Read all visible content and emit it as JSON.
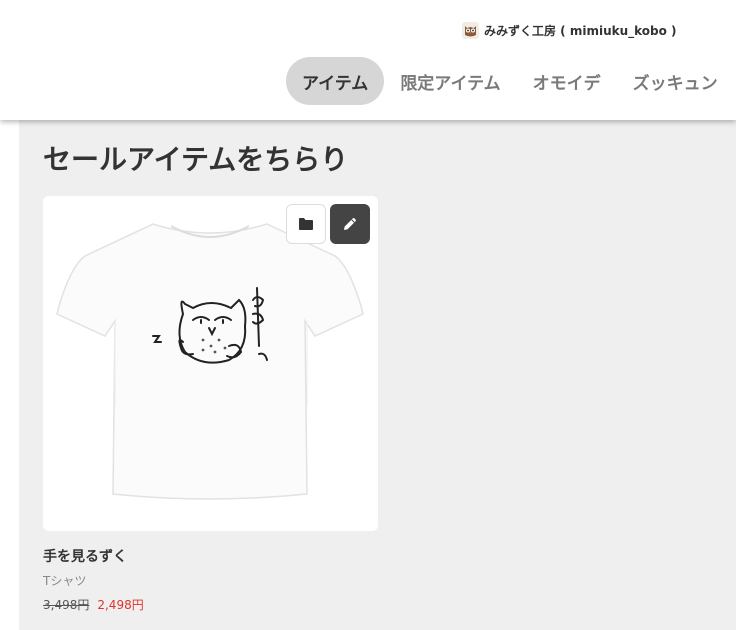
{
  "header": {
    "shop_name": "みみずく工房 ( mimiuku_kobo )",
    "nav_tabs": [
      {
        "label": "アイテム",
        "active": true
      },
      {
        "label": "限定アイテム",
        "active": false
      },
      {
        "label": "オモイデ",
        "active": false
      },
      {
        "label": "ズッキュン",
        "active": false
      }
    ]
  },
  "main": {
    "title": "セールアイテムをちらり",
    "items": [
      {
        "title": "手を見るずく",
        "type": "Tシャツ",
        "original_price": "3,498円",
        "sale_price": "2,498円"
      }
    ]
  },
  "icons": {
    "avatar": "owl-avatar-icon",
    "folder": "folder-icon",
    "edit": "pencil-icon"
  },
  "colors": {
    "active_tab_bg": "#d6d6d6",
    "content_bg": "#efefef",
    "sale_price": "#e0332d",
    "edit_button": "#444444"
  }
}
